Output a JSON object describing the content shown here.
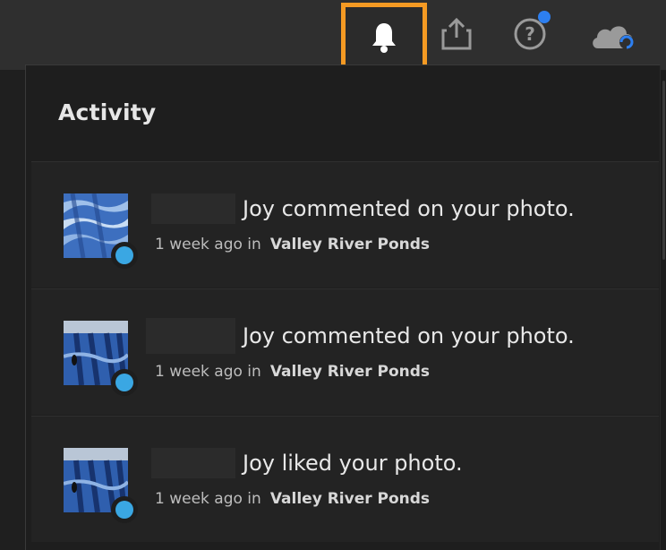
{
  "toolbar": {
    "icons": [
      "bell-icon",
      "share-icon",
      "help-icon",
      "cloud-sync-icon"
    ],
    "highlight_color": "#f59a23",
    "notification_dot_color": "#2d7ff0"
  },
  "panel": {
    "title": "Activity",
    "items": [
      {
        "text": "Joy commented on your photo.",
        "time": "1 week ago in",
        "place": "Valley River Ponds"
      },
      {
        "text": "Joy commented on your photo.",
        "time": "1 week ago in",
        "place": "Valley River Ponds"
      },
      {
        "text": "Joy liked your photo.",
        "time": "1 week ago in",
        "place": "Valley River Ponds"
      }
    ],
    "badge_color": "#3aa7e3"
  }
}
